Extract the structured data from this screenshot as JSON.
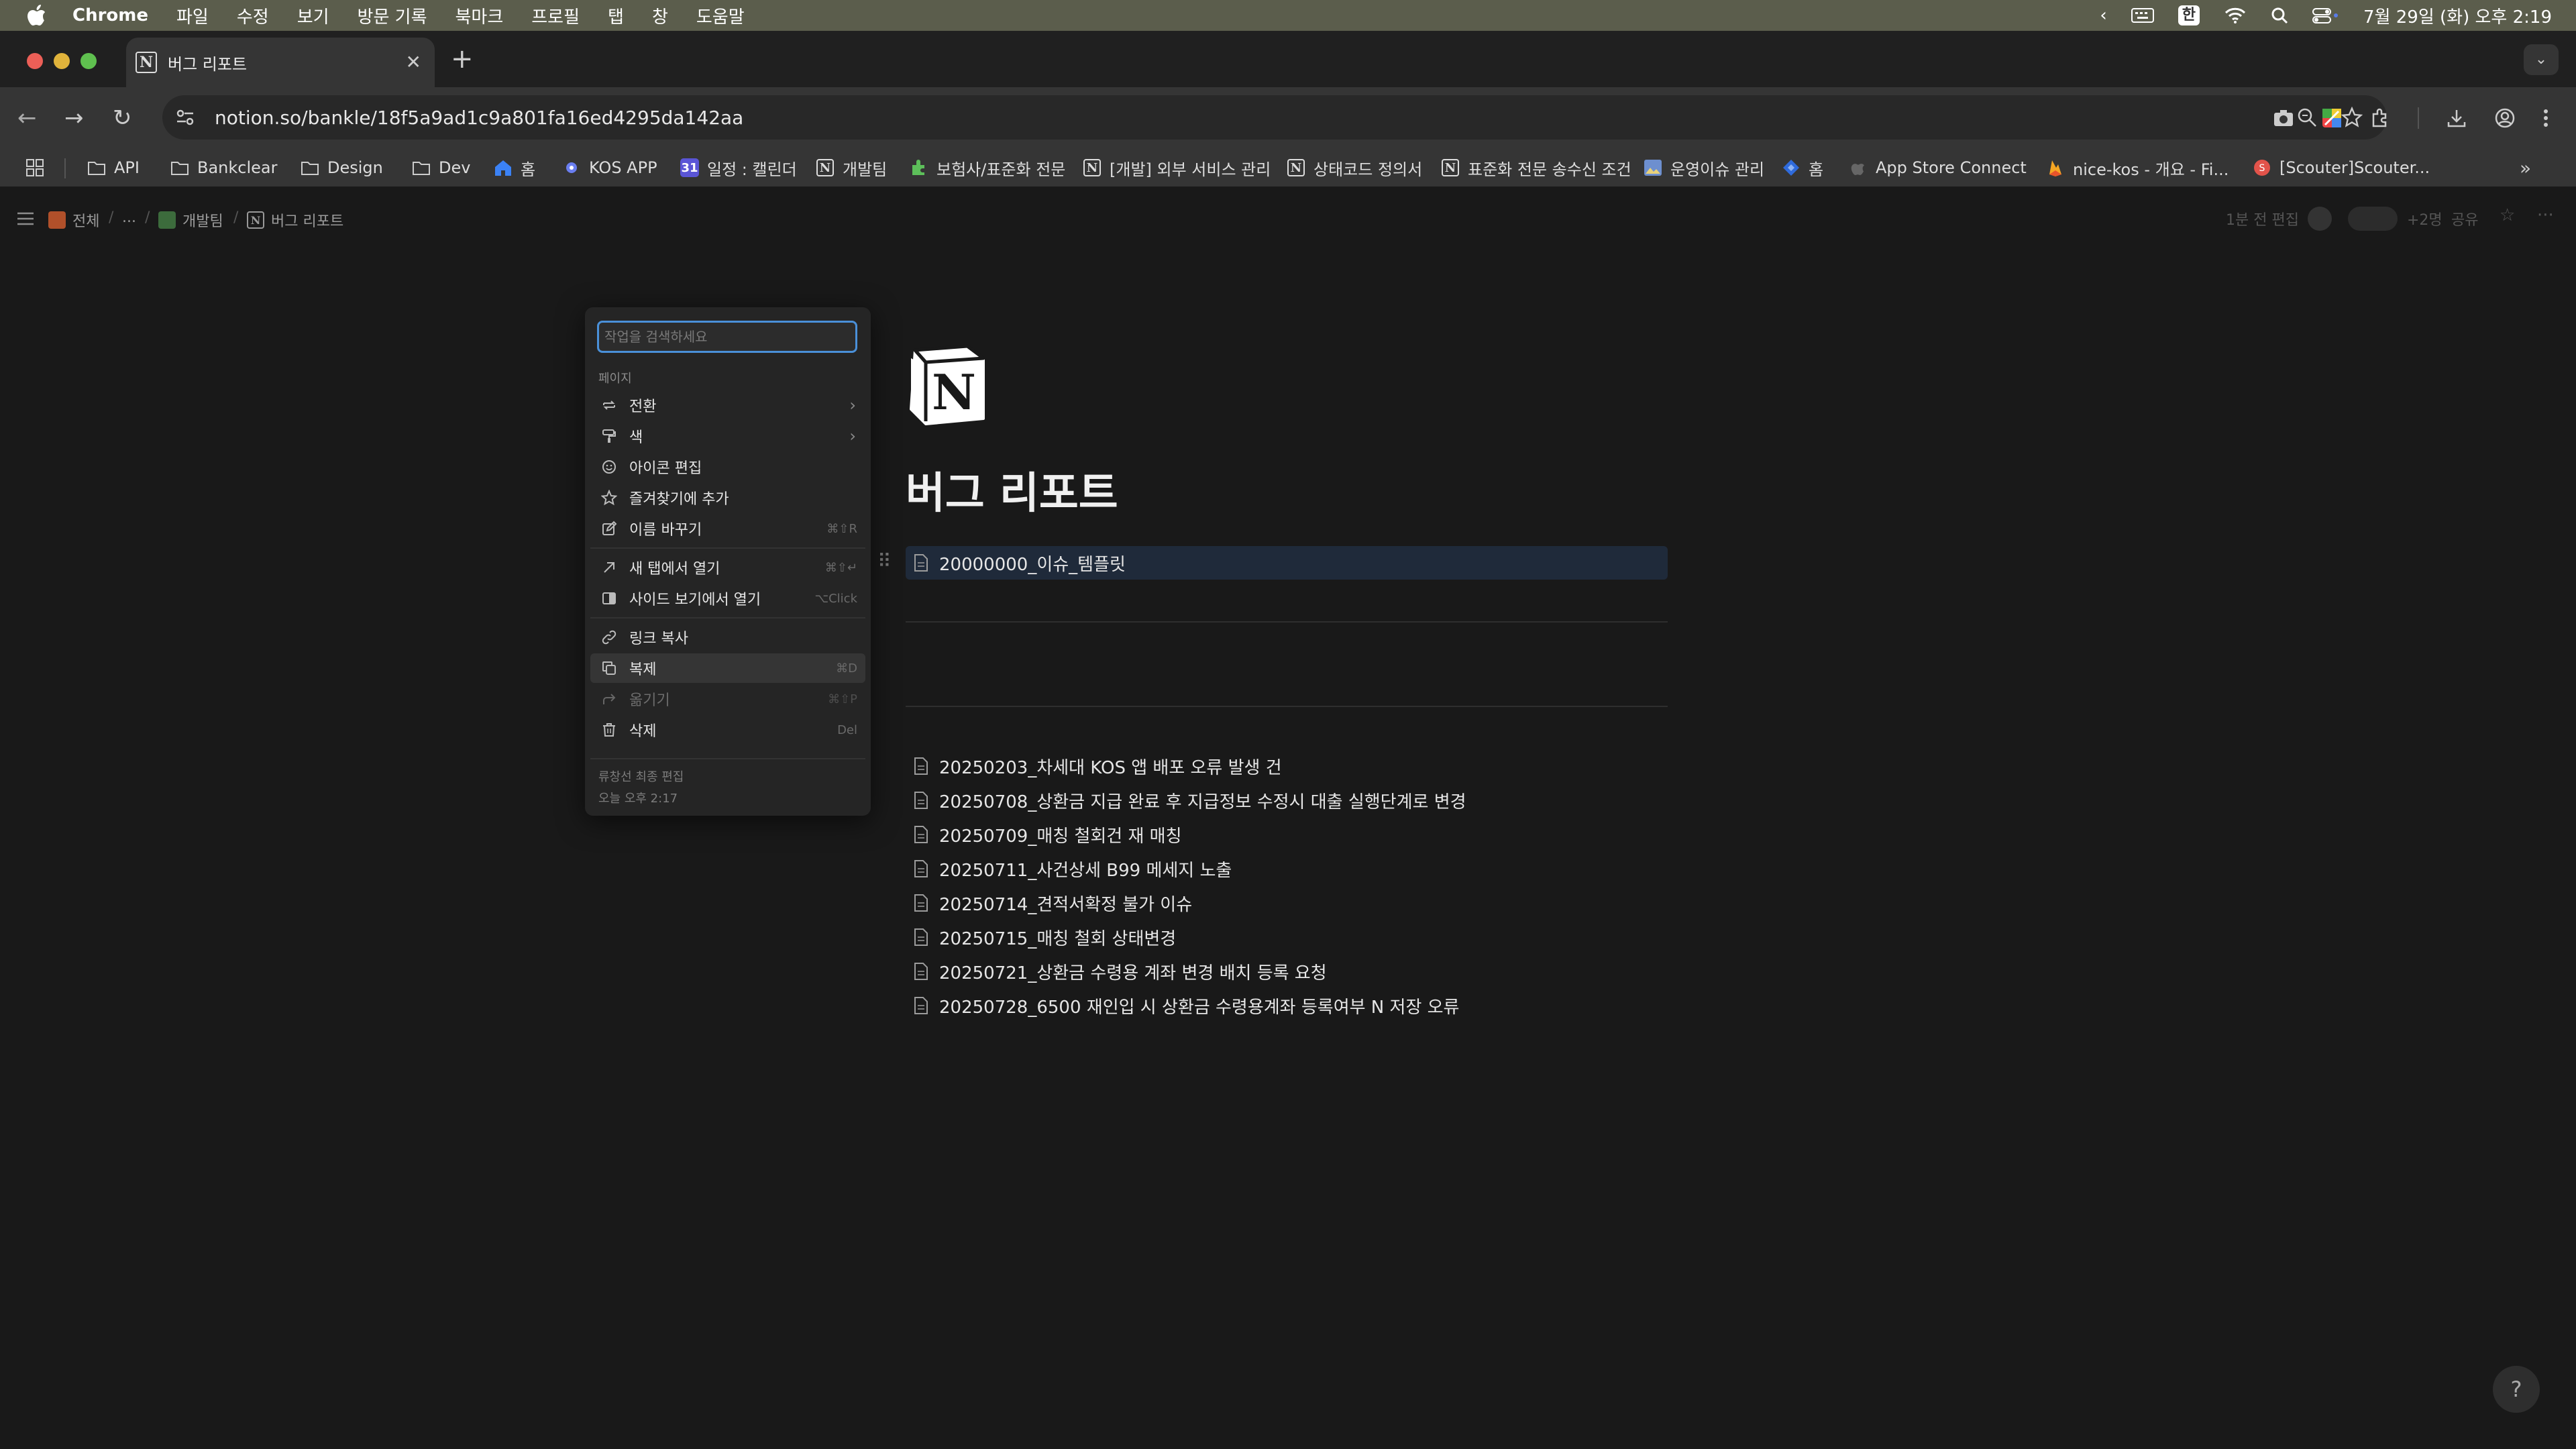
{
  "menubar": {
    "app_name": "Chrome",
    "items": [
      "파일",
      "수정",
      "보기",
      "방문 기록",
      "북마크",
      "프로필",
      "탭",
      "창",
      "도움말"
    ],
    "input_source": "한",
    "datetime": "7월 29일 (화) 오후 2:19"
  },
  "browser": {
    "tab_title": "버그 리포트",
    "new_tab_label": "+",
    "url": "notion.so/bankle/18f5a9ad1c9a801fa16ed4295da142aa"
  },
  "bookmarks": [
    {
      "label": "API",
      "icon": "folder-icon"
    },
    {
      "label": "Bankclear",
      "icon": "folder-icon"
    },
    {
      "label": "Design",
      "icon": "folder-icon"
    },
    {
      "label": "Dev",
      "icon": "folder-icon"
    },
    {
      "label": "홈",
      "icon": "home-icon"
    },
    {
      "label": "KOS APP",
      "icon": "app-icon"
    },
    {
      "label": "일정 : 캘린더",
      "icon": "calendar-icon"
    },
    {
      "label": "개발팀",
      "icon": "notion-icon"
    },
    {
      "label": "보험사/표준화 전문",
      "icon": "puzzle-icon"
    },
    {
      "label": "[개발] 외부 서비스 관리",
      "icon": "notion-icon"
    },
    {
      "label": "상태코드 정의서",
      "icon": "notion-icon"
    },
    {
      "label": "표준화 전문 송수신 조건",
      "icon": "notion-icon"
    },
    {
      "label": "운영이슈 관리",
      "icon": "image-icon"
    },
    {
      "label": "홈",
      "icon": "jira-icon"
    },
    {
      "label": "App Store Connect",
      "icon": "apple-icon"
    },
    {
      "label": "nice-kos - 개요 - Fi...",
      "icon": "firebase-icon"
    },
    {
      "label": "[Scouter]Scouter...",
      "icon": "scouter-icon"
    }
  ],
  "notion_topbar": {
    "breadcrumb": [
      "전체",
      "...",
      "개발팀",
      "버그 리포트"
    ],
    "edited": "1분 전 편집",
    "member_count": "+2명",
    "share": "공유"
  },
  "page": {
    "title": "버그 리포트",
    "template_item": "20000000_이슈_템플릿",
    "items": [
      "20250203_차세대 KOS 앱 배포 오류 발생 건",
      "20250708_상환금 지급 완료 후 지급정보 수정시 대출 실행단계로 변경",
      "20250709_매칭 철회건 재 매칭",
      "20250711_사건상세 B99 메세지 노출",
      "20250714_견적서확정 불가 이슈",
      "20250715_매칭 철회 상태변경",
      "20250721_상환금 수령용 계좌 변경 배치 등록 요청",
      "20250728_6500 재인입 시 상환금 수령용계좌 등록여부 N 저장 오류"
    ]
  },
  "context_menu": {
    "search_placeholder": "작업을 검색하세요",
    "section_label": "페이지",
    "items": [
      {
        "label": "전환",
        "icon": "turn-into-icon",
        "submenu": true
      },
      {
        "label": "색",
        "icon": "paint-icon",
        "submenu": true
      },
      {
        "label": "아이콘 편집",
        "icon": "smile-icon"
      },
      {
        "label": "즐겨찾기에 추가",
        "icon": "star-icon"
      },
      {
        "label": "이름 바꾸기",
        "icon": "rename-icon",
        "shortcut": "⌘⇧R"
      },
      {
        "label": "새 탭에서 열기",
        "icon": "arrow-up-right-icon",
        "shortcut": "⌘⇧↵"
      },
      {
        "label": "사이드 보기에서 열기",
        "icon": "side-peek-icon",
        "shortcut": "⌥Click"
      },
      {
        "label": "링크 복사",
        "icon": "link-icon"
      },
      {
        "label": "복제",
        "icon": "duplicate-icon",
        "shortcut": "⌘D"
      },
      {
        "label": "옮기기",
        "icon": "move-icon",
        "shortcut": "⌘⇧P"
      },
      {
        "label": "삭제",
        "icon": "trash-icon",
        "shortcut": "Del"
      }
    ],
    "footer_by": "류창선 최종 편집",
    "footer_time": "오늘 오후 2:17"
  },
  "colors": {
    "background": "#191919",
    "menu_bg": "#252525",
    "accent": "#4a90d9",
    "selected_row": "#1f2a3a"
  }
}
